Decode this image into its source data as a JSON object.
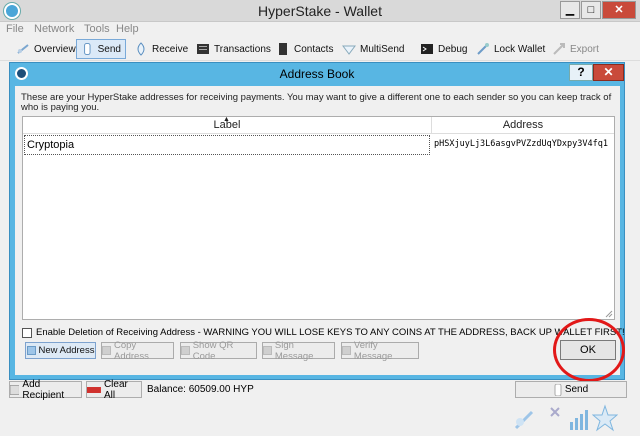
{
  "window": {
    "title": "HyperStake - Wallet",
    "minimize": "▁",
    "maximize": "□",
    "close": "✕"
  },
  "menu": [
    "File",
    "Network",
    "Tools",
    "Help"
  ],
  "toolbar": [
    {
      "label": "Overview",
      "icon": "overview-icon"
    },
    {
      "label": "Send",
      "icon": "send-icon",
      "active": true
    },
    {
      "label": "Receive",
      "icon": "receive-icon"
    },
    {
      "label": "Transactions",
      "icon": "transactions-icon"
    },
    {
      "label": "Contacts",
      "icon": "contacts-icon"
    },
    {
      "label": "MultiSend",
      "icon": "multisend-icon"
    },
    {
      "label": "Debug",
      "icon": "debug-icon"
    },
    {
      "label": "Lock Wallet",
      "icon": "lock-icon"
    },
    {
      "label": "Export",
      "icon": "export-icon",
      "disabled": true
    }
  ],
  "dialog": {
    "title": "Address Book",
    "help": "?",
    "close": "✕",
    "description": "These are your HyperStake addresses for receiving payments. You may want to give a different one to each sender so you can keep track of who is paying you.",
    "columns": {
      "label": "Label",
      "address": "Address"
    },
    "rows": [
      {
        "label": "Cryptopia",
        "address": "pHSXjuyLj3L6asgvPVZzdUqYDxpy3V4fq1"
      }
    ],
    "enable_deletion": "Enable Deletion of Receiving Address - WARNING YOU WILL LOSE KEYS TO ANY COINS AT THE ADDRESS, BACK UP WALLET FIRST!",
    "buttons": {
      "new_address": "New Address",
      "copy_address": "Copy Address",
      "show_qr": "Show QR Code",
      "sign_message": "Sign Message",
      "verify_message": "Verify Message",
      "ok": "OK"
    }
  },
  "bottom": {
    "add_recipient": "Add Recipient",
    "clear_all": "Clear All",
    "balance": "Balance: 60509.00 HYP",
    "send": "Send"
  },
  "colors": {
    "dialog_frame": "#58b6e3",
    "annotation": "#e21818",
    "close": "#c94a3a"
  }
}
